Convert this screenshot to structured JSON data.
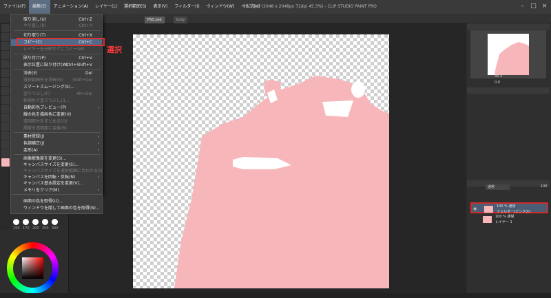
{
  "window": {
    "title": "PSD.psd (2048 x 2048px 72dpi 45.3%) - CLIP STUDIO PAINT PRO",
    "minimize_icon": "minimize-icon",
    "maximize_icon": "maximize-icon",
    "close_icon": "close-icon"
  },
  "menubar": [
    {
      "label": "ファイル(F)"
    },
    {
      "label": "編集(E)"
    },
    {
      "label": "アニメーション(A)"
    },
    {
      "label": "レイヤー(L)"
    },
    {
      "label": "選択範囲(S)"
    },
    {
      "label": "表示(V)"
    },
    {
      "label": "フィルター(I)"
    },
    {
      "label": "ウィンドウ(W)"
    },
    {
      "label": "ヘルプ(H)"
    }
  ],
  "doc_tabs": [
    {
      "label": "PSD.psd"
    },
    {
      "label": "body"
    }
  ],
  "edit_menu": {
    "items": [
      {
        "label": "取り消し(U)",
        "shortcut": "Ctrl+Z",
        "enabled": true
      },
      {
        "label": "やり直し(R)",
        "shortcut": "Ctrl+Y",
        "enabled": false
      },
      {
        "label": "切り取り(T)",
        "shortcut": "Ctrl+X",
        "enabled": true
      },
      {
        "label": "コピー(C)",
        "shortcut": "Ctrl+C",
        "enabled": true,
        "highlight": true
      },
      {
        "label": "レイヤーを分割せずにコピー(W)",
        "shortcut": "",
        "enabled": false
      },
      {
        "label": "貼り付け(P)",
        "shortcut": "Ctrl+V",
        "enabled": true
      },
      {
        "label": "表示位置に貼り付け(W)",
        "shortcut": "Ctrl+Shift+V",
        "enabled": true
      },
      {
        "label": "消去(E)",
        "shortcut": "Del",
        "enabled": true
      },
      {
        "label": "選択範囲外を消去(N)",
        "shortcut": "Shift+Del",
        "enabled": false
      },
      {
        "label": "スマートスムージング(S)...",
        "shortcut": "",
        "enabled": true
      },
      {
        "label": "塗りつぶし(F)",
        "shortcut": "Alt+Del",
        "enabled": false
      },
      {
        "label": "新規色で塗りつぶし(I)...",
        "shortcut": "",
        "enabled": false
      },
      {
        "label": "自動彩色プレビュー(P)",
        "shortcut": "",
        "enabled": true,
        "submenu": true
      },
      {
        "label": "線の色を描画色に変更(H)",
        "shortcut": "",
        "enabled": true
      },
      {
        "label": "透明部分をまとめる(O)",
        "shortcut": "",
        "enabled": false
      },
      {
        "label": "輝度を透明度に変換(B)",
        "shortcut": "",
        "enabled": false
      },
      {
        "label": "素材登録(J)",
        "shortcut": "",
        "enabled": true,
        "submenu": true
      },
      {
        "label": "色調補正(J)",
        "shortcut": "",
        "enabled": true,
        "submenu": true
      },
      {
        "label": "変形(A)",
        "shortcut": "",
        "enabled": true,
        "submenu": true
      },
      {
        "label": "画像解像度を変更(S)...",
        "shortcut": "",
        "enabled": true
      },
      {
        "label": "キャンバスサイズを変更(S)...",
        "shortcut": "",
        "enabled": true
      },
      {
        "label": "キャンバスサイズを選択範囲に合わせる(I)",
        "shortcut": "",
        "enabled": false
      },
      {
        "label": "キャンバスを回転・反転(N)",
        "shortcut": "",
        "enabled": true,
        "submenu": true
      },
      {
        "label": "キャンバス基本設定を変更(V)...",
        "shortcut": "",
        "enabled": true
      },
      {
        "label": "メモリをクリア(M)",
        "shortcut": "",
        "enabled": true,
        "submenu": true
      },
      {
        "label": "画面の色を取得(U)...",
        "shortcut": "",
        "enabled": true
      },
      {
        "label": "ウィンドウを隠して画面の色を取得(N)...",
        "shortcut": "",
        "enabled": true
      }
    ]
  },
  "callout": {
    "text": "選択"
  },
  "brush_sizes": [
    "150",
    "170",
    "200",
    "250",
    "300"
  ],
  "layer_panel": {
    "blend_mode": "通常",
    "opacity": "100",
    "layers": [
      {
        "line1": "100 % 通常",
        "line2": "フォルダー[ピンクの]",
        "selected": true
      },
      {
        "line1": "100 % 通常",
        "line2": "レイヤー 1",
        "selected": false
      }
    ]
  },
  "right_panel": {
    "navigator_zoom": "45.3",
    "navigator_angle": "0.0"
  },
  "colors": {
    "accent": "#526a8a",
    "callout_red": "#e03030",
    "pink_fill": "#f7b7ba"
  }
}
